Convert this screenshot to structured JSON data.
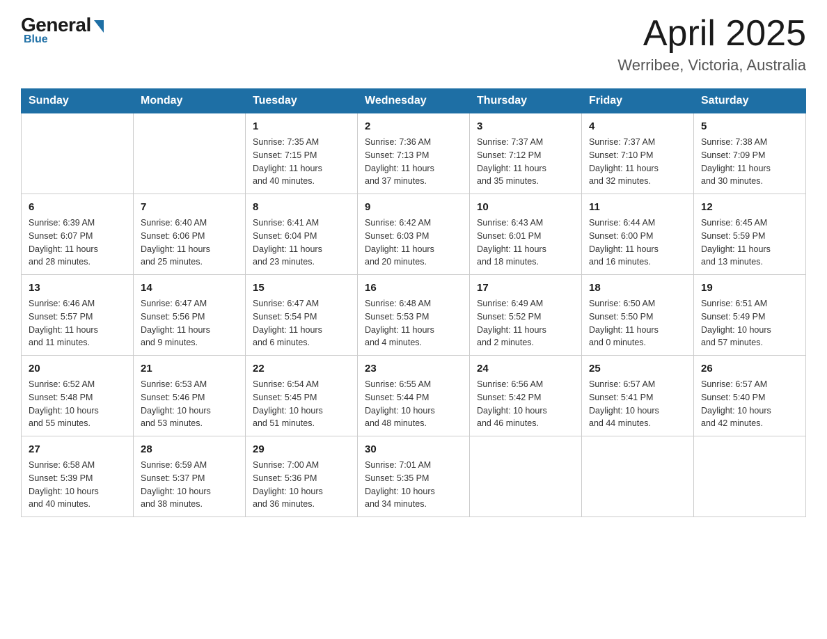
{
  "logo": {
    "general": "General",
    "blue": "Blue",
    "tagline": "Blue"
  },
  "title": {
    "month": "April 2025",
    "location": "Werribee, Victoria, Australia"
  },
  "weekdays": [
    "Sunday",
    "Monday",
    "Tuesday",
    "Wednesday",
    "Thursday",
    "Friday",
    "Saturday"
  ],
  "weeks": [
    [
      {
        "day": "",
        "info": ""
      },
      {
        "day": "",
        "info": ""
      },
      {
        "day": "1",
        "info": "Sunrise: 7:35 AM\nSunset: 7:15 PM\nDaylight: 11 hours\nand 40 minutes."
      },
      {
        "day": "2",
        "info": "Sunrise: 7:36 AM\nSunset: 7:13 PM\nDaylight: 11 hours\nand 37 minutes."
      },
      {
        "day": "3",
        "info": "Sunrise: 7:37 AM\nSunset: 7:12 PM\nDaylight: 11 hours\nand 35 minutes."
      },
      {
        "day": "4",
        "info": "Sunrise: 7:37 AM\nSunset: 7:10 PM\nDaylight: 11 hours\nand 32 minutes."
      },
      {
        "day": "5",
        "info": "Sunrise: 7:38 AM\nSunset: 7:09 PM\nDaylight: 11 hours\nand 30 minutes."
      }
    ],
    [
      {
        "day": "6",
        "info": "Sunrise: 6:39 AM\nSunset: 6:07 PM\nDaylight: 11 hours\nand 28 minutes."
      },
      {
        "day": "7",
        "info": "Sunrise: 6:40 AM\nSunset: 6:06 PM\nDaylight: 11 hours\nand 25 minutes."
      },
      {
        "day": "8",
        "info": "Sunrise: 6:41 AM\nSunset: 6:04 PM\nDaylight: 11 hours\nand 23 minutes."
      },
      {
        "day": "9",
        "info": "Sunrise: 6:42 AM\nSunset: 6:03 PM\nDaylight: 11 hours\nand 20 minutes."
      },
      {
        "day": "10",
        "info": "Sunrise: 6:43 AM\nSunset: 6:01 PM\nDaylight: 11 hours\nand 18 minutes."
      },
      {
        "day": "11",
        "info": "Sunrise: 6:44 AM\nSunset: 6:00 PM\nDaylight: 11 hours\nand 16 minutes."
      },
      {
        "day": "12",
        "info": "Sunrise: 6:45 AM\nSunset: 5:59 PM\nDaylight: 11 hours\nand 13 minutes."
      }
    ],
    [
      {
        "day": "13",
        "info": "Sunrise: 6:46 AM\nSunset: 5:57 PM\nDaylight: 11 hours\nand 11 minutes."
      },
      {
        "day": "14",
        "info": "Sunrise: 6:47 AM\nSunset: 5:56 PM\nDaylight: 11 hours\nand 9 minutes."
      },
      {
        "day": "15",
        "info": "Sunrise: 6:47 AM\nSunset: 5:54 PM\nDaylight: 11 hours\nand 6 minutes."
      },
      {
        "day": "16",
        "info": "Sunrise: 6:48 AM\nSunset: 5:53 PM\nDaylight: 11 hours\nand 4 minutes."
      },
      {
        "day": "17",
        "info": "Sunrise: 6:49 AM\nSunset: 5:52 PM\nDaylight: 11 hours\nand 2 minutes."
      },
      {
        "day": "18",
        "info": "Sunrise: 6:50 AM\nSunset: 5:50 PM\nDaylight: 11 hours\nand 0 minutes."
      },
      {
        "day": "19",
        "info": "Sunrise: 6:51 AM\nSunset: 5:49 PM\nDaylight: 10 hours\nand 57 minutes."
      }
    ],
    [
      {
        "day": "20",
        "info": "Sunrise: 6:52 AM\nSunset: 5:48 PM\nDaylight: 10 hours\nand 55 minutes."
      },
      {
        "day": "21",
        "info": "Sunrise: 6:53 AM\nSunset: 5:46 PM\nDaylight: 10 hours\nand 53 minutes."
      },
      {
        "day": "22",
        "info": "Sunrise: 6:54 AM\nSunset: 5:45 PM\nDaylight: 10 hours\nand 51 minutes."
      },
      {
        "day": "23",
        "info": "Sunrise: 6:55 AM\nSunset: 5:44 PM\nDaylight: 10 hours\nand 48 minutes."
      },
      {
        "day": "24",
        "info": "Sunrise: 6:56 AM\nSunset: 5:42 PM\nDaylight: 10 hours\nand 46 minutes."
      },
      {
        "day": "25",
        "info": "Sunrise: 6:57 AM\nSunset: 5:41 PM\nDaylight: 10 hours\nand 44 minutes."
      },
      {
        "day": "26",
        "info": "Sunrise: 6:57 AM\nSunset: 5:40 PM\nDaylight: 10 hours\nand 42 minutes."
      }
    ],
    [
      {
        "day": "27",
        "info": "Sunrise: 6:58 AM\nSunset: 5:39 PM\nDaylight: 10 hours\nand 40 minutes."
      },
      {
        "day": "28",
        "info": "Sunrise: 6:59 AM\nSunset: 5:37 PM\nDaylight: 10 hours\nand 38 minutes."
      },
      {
        "day": "29",
        "info": "Sunrise: 7:00 AM\nSunset: 5:36 PM\nDaylight: 10 hours\nand 36 minutes."
      },
      {
        "day": "30",
        "info": "Sunrise: 7:01 AM\nSunset: 5:35 PM\nDaylight: 10 hours\nand 34 minutes."
      },
      {
        "day": "",
        "info": ""
      },
      {
        "day": "",
        "info": ""
      },
      {
        "day": "",
        "info": ""
      }
    ]
  ]
}
